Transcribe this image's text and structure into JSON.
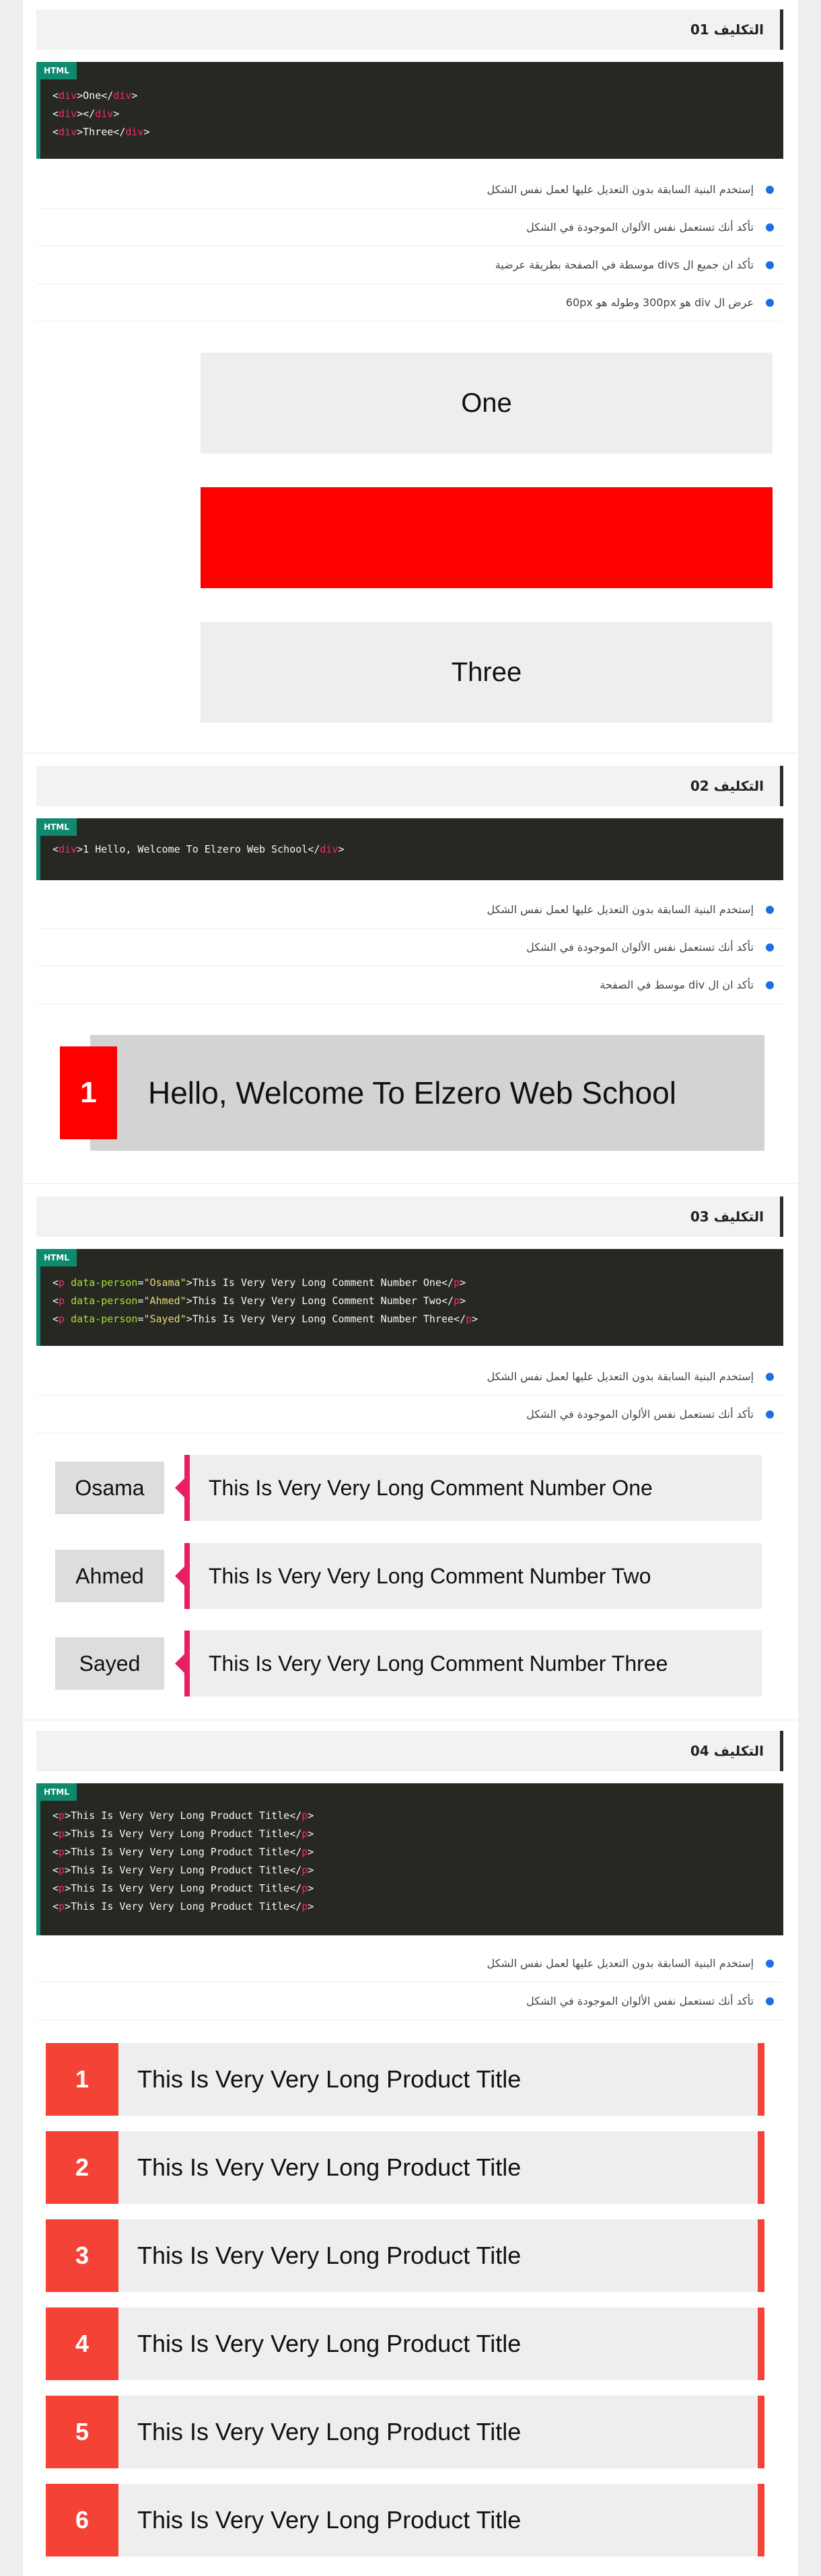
{
  "html_badge": "HTML",
  "assignments": [
    {
      "title": "التكليف 01",
      "code_lines": [
        [
          {
            "t": "<",
            "c": ""
          },
          {
            "t": "div",
            "c": "tag"
          },
          {
            "t": ">One</",
            "c": ""
          },
          {
            "t": "div",
            "c": "tag"
          },
          {
            "t": ">",
            "c": ""
          }
        ],
        [
          {
            "t": "<",
            "c": ""
          },
          {
            "t": "div",
            "c": "tag"
          },
          {
            "t": "></",
            "c": ""
          },
          {
            "t": "div",
            "c": "tag"
          },
          {
            "t": ">",
            "c": ""
          }
        ],
        [
          {
            "t": "<",
            "c": ""
          },
          {
            "t": "div",
            "c": "tag"
          },
          {
            "t": ">Three</",
            "c": ""
          },
          {
            "t": "div",
            "c": "tag"
          },
          {
            "t": ">",
            "c": ""
          }
        ]
      ],
      "requirements": [
        "إستخدم البنية السابقة بدون التعديل عليها لعمل نفس الشكل",
        "تأكد أنك تستعمل نفس الألوان الموجودة في الشكل",
        "تأكد ان جميع ال divs موسطة في الصفحة بطريقة عرضية",
        "عرض ال div هو 300px وطوله هو 60px"
      ],
      "demo": {
        "boxes": [
          "One",
          "",
          "Three"
        ],
        "colors": [
          "#eeeeee",
          "#ff0000",
          "#eeeeee"
        ]
      }
    },
    {
      "title": "التكليف 02",
      "code_lines": [
        [
          {
            "t": "<",
            "c": ""
          },
          {
            "t": "div",
            "c": "tag"
          },
          {
            "t": ">1 Hello, Welcome To Elzero Web School</",
            "c": ""
          },
          {
            "t": "div",
            "c": "tag"
          },
          {
            "t": ">",
            "c": ""
          }
        ]
      ],
      "requirements": [
        "إستخدم البنية السابقة بدون التعديل عليها لعمل نفس الشكل",
        "تأكد أنك تستعمل نفس الألوان الموجودة في الشكل",
        "تأكد ان ال div موسط في الصفحة"
      ],
      "demo": {
        "number": "1",
        "text": "Hello, Welcome To Elzero Web School"
      }
    },
    {
      "title": "التكليف 03",
      "code_lines": [
        [
          {
            "t": "<",
            "c": ""
          },
          {
            "t": "p",
            "c": "tag"
          },
          {
            "t": " ",
            "c": ""
          },
          {
            "t": "data-person",
            "c": "attr"
          },
          {
            "t": "=",
            "c": ""
          },
          {
            "t": "\"Osama\"",
            "c": "str"
          },
          {
            "t": ">This Is Very Very Long Comment Number One</",
            "c": ""
          },
          {
            "t": "p",
            "c": "tag"
          },
          {
            "t": ">",
            "c": ""
          }
        ],
        [
          {
            "t": "<",
            "c": ""
          },
          {
            "t": "p",
            "c": "tag"
          },
          {
            "t": " ",
            "c": ""
          },
          {
            "t": "data-person",
            "c": "attr"
          },
          {
            "t": "=",
            "c": ""
          },
          {
            "t": "\"Ahmed\"",
            "c": "str"
          },
          {
            "t": ">This Is Very Very Long Comment Number Two</",
            "c": ""
          },
          {
            "t": "p",
            "c": "tag"
          },
          {
            "t": ">",
            "c": ""
          }
        ],
        [
          {
            "t": "<",
            "c": ""
          },
          {
            "t": "p",
            "c": "tag"
          },
          {
            "t": " ",
            "c": ""
          },
          {
            "t": "data-person",
            "c": "attr"
          },
          {
            "t": "=",
            "c": ""
          },
          {
            "t": "\"Sayed\"",
            "c": "str"
          },
          {
            "t": ">This Is Very Very Long Comment Number Three</",
            "c": ""
          },
          {
            "t": "p",
            "c": "tag"
          },
          {
            "t": ">",
            "c": ""
          }
        ]
      ],
      "requirements": [
        "إستخدم البنية السابقة بدون التعديل عليها لعمل نفس الشكل",
        "تأكد أنك تستعمل نفس الألوان الموجودة في الشكل"
      ],
      "demo": {
        "comments": [
          {
            "person": "Osama",
            "text": "This Is Very Very Long Comment Number One"
          },
          {
            "person": "Ahmed",
            "text": "This Is Very Very Long Comment Number Two"
          },
          {
            "person": "Sayed",
            "text": "This Is Very Very Long Comment Number Three"
          }
        ]
      }
    },
    {
      "title": "التكليف 04",
      "code_lines": [
        [
          {
            "t": "<",
            "c": ""
          },
          {
            "t": "p",
            "c": "tag"
          },
          {
            "t": ">This Is Very Very Long Product Title</",
            "c": ""
          },
          {
            "t": "p",
            "c": "tag"
          },
          {
            "t": ">",
            "c": ""
          }
        ],
        [
          {
            "t": "<",
            "c": ""
          },
          {
            "t": "p",
            "c": "tag"
          },
          {
            "t": ">This Is Very Very Long Product Title</",
            "c": ""
          },
          {
            "t": "p",
            "c": "tag"
          },
          {
            "t": ">",
            "c": ""
          }
        ],
        [
          {
            "t": "<",
            "c": ""
          },
          {
            "t": "p",
            "c": "tag"
          },
          {
            "t": ">This Is Very Very Long Product Title</",
            "c": ""
          },
          {
            "t": "p",
            "c": "tag"
          },
          {
            "t": ">",
            "c": ""
          }
        ],
        [
          {
            "t": "<",
            "c": ""
          },
          {
            "t": "p",
            "c": "tag"
          },
          {
            "t": ">This Is Very Very Long Product Title</",
            "c": ""
          },
          {
            "t": "p",
            "c": "tag"
          },
          {
            "t": ">",
            "c": ""
          }
        ],
        [
          {
            "t": "<",
            "c": ""
          },
          {
            "t": "p",
            "c": "tag"
          },
          {
            "t": ">This Is Very Very Long Product Title</",
            "c": ""
          },
          {
            "t": "p",
            "c": "tag"
          },
          {
            "t": ">",
            "c": ""
          }
        ],
        [
          {
            "t": "<",
            "c": ""
          },
          {
            "t": "p",
            "c": "tag"
          },
          {
            "t": ">This Is Very Very Long Product Title</",
            "c": ""
          },
          {
            "t": "p",
            "c": "tag"
          },
          {
            "t": ">",
            "c": ""
          }
        ]
      ],
      "requirements": [
        "إستخدم البنية السابقة بدون التعديل عليها لعمل نفس الشكل",
        "تأكد أنك تستعمل نفس الألوان الموجودة في الشكل"
      ],
      "demo": {
        "products": [
          {
            "number": "1",
            "title": "This Is Very Very Long Product Title"
          },
          {
            "number": "2",
            "title": "This Is Very Very Long Product Title"
          },
          {
            "number": "3",
            "title": "This Is Very Very Long Product Title"
          },
          {
            "number": "4",
            "title": "This Is Very Very Long Product Title"
          },
          {
            "number": "5",
            "title": "This Is Very Very Long Product Title"
          },
          {
            "number": "6",
            "title": "This Is Very Very Long Product Title"
          }
        ]
      }
    }
  ]
}
